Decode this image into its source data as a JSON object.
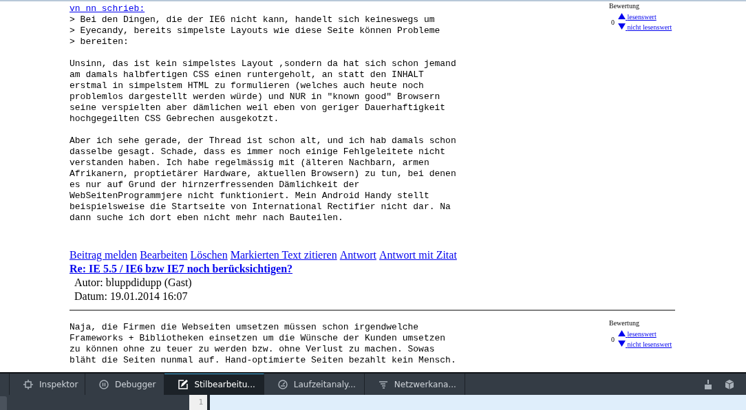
{
  "posts": [
    {
      "quote_link": "vn nn schrieb:",
      "paragraphs": [
        [
          "> Bei den Dingen, die der IE6 nicht kann, handelt sich keineswegs um",
          "> Eyecandy, bereits simpelste Layouts wie diese Seite können Probleme",
          "> bereiten:"
        ],
        [
          "Unsinn, das ist kein simpelstes Layout ,sondern da hat sich schon jemand",
          "am damals halbfertigen CSS einen runtergeholt, an statt den INHALT",
          "erstmal in simpelstem HTML zu formulieren (welches auch heute noch",
          "problemlos dargestellt werden würde) und NUR in \"known good\" Browsern",
          "seine verspielten aber dämlichen weil eben von geriger Dauerhaftigkeit",
          "hochgegeilten CSS Gebrechen ausgekotzt."
        ],
        [
          "Aber ich sehe gerade, der Thread ist schon alt, und ich hab damals schon",
          "dasselbe gesagt. Schade, dass es immer noch einige Fehlgeleitete nicht",
          "verstanden haben. Ich habe regelmässig mit (älteren Nachbarn, armen",
          "Afrikanern, proptietärer Hardware, aktuellen Browsern) zu tun, bei denen",
          "es nur auf Grund der hirnzerfressenden Dämlichkeit der",
          "WebSeitenProgrammjere nicht funktioniert. Mein Android Handy stellt",
          "beispielsweise die Startseite von International Rectifier nicht dar. Na",
          "dann suche ich dort eben nicht mehr nach Bauteilen."
        ]
      ],
      "rating": {
        "label": "Bewertung",
        "score": "0",
        "up": "lesenswert",
        "down": "nicht lesenswert"
      },
      "actions": [
        "Beitrag melden",
        "Bearbeiten",
        "Löschen",
        "Markierten Text zitieren",
        "Antwort",
        "Antwort mit Zitat"
      ]
    },
    {
      "title": "Re: IE 5.5 / IE6 bzw IE7 noch berücksichtigen?",
      "author": "Autor: bluppdidupp (Gast)",
      "date": "Datum: 19.01.2014 16:07",
      "paragraphs": [
        [
          "Naja, die Firmen die Webseiten umsetzen müssen schon irgendwelche",
          "Frameworks + Bibliotheken einsetzen um die Wünsche der Kunden umsetzen",
          "zu können ohne zu teuer zu werden bzw. ohne Verlust zu machen. Sowas",
          "bläht die Seiten nunmal auf. Hand-optimierte Seiten bezahlt kein Mensch."
        ]
      ],
      "rating": {
        "label": "Bewertung",
        "score": "0",
        "up": "lesenswert",
        "down": "nicht lesenswert"
      }
    }
  ],
  "devtools": {
    "tabs": [
      {
        "label": "Inspektor",
        "kind": "inspector",
        "selected": false
      },
      {
        "label": "Debugger",
        "kind": "debugger",
        "selected": false
      },
      {
        "label": "Stilbearbeitu...",
        "kind": "style",
        "selected": true
      },
      {
        "label": "Laufzeitanaly...",
        "kind": "performance",
        "selected": false
      },
      {
        "label": "Netzwerkana...",
        "kind": "network",
        "selected": false
      }
    ],
    "line_number": "1"
  }
}
